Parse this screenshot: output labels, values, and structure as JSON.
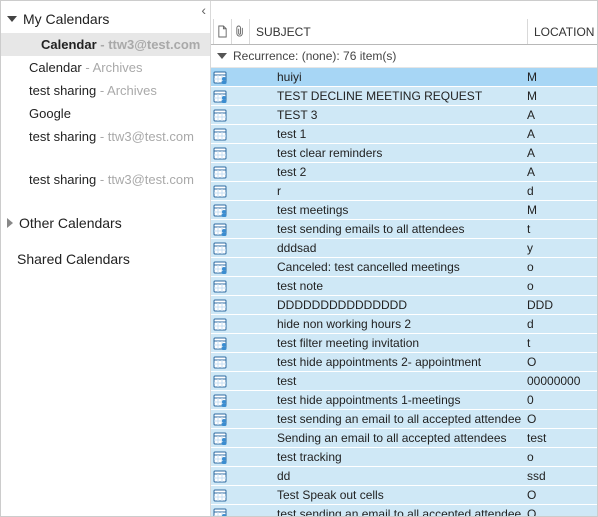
{
  "sidebar": {
    "collapse_glyph": "‹",
    "groups": [
      {
        "name": "my-calendars",
        "label": "My Calendars",
        "expanded": true,
        "items": [
          {
            "label": "Calendar",
            "suffix": " - ttw3@test.com",
            "selected": true
          },
          {
            "label": "Calendar",
            "suffix": " - Archives",
            "selected": false
          },
          {
            "label": "test sharing",
            "suffix": " - Archives",
            "selected": false
          },
          {
            "label": "Google",
            "suffix": "",
            "selected": false
          },
          {
            "label": "test sharing",
            "suffix": " - ttw3@test.com",
            "selected": false
          },
          {
            "label": "test sharing",
            "suffix": " - ttw3@test.com",
            "selected": false,
            "gapBefore": true
          }
        ]
      },
      {
        "name": "other-calendars",
        "label": "Other Calendars",
        "expanded": false,
        "items": []
      },
      {
        "name": "shared-calendars",
        "label": "Shared Calendars",
        "expanded": null,
        "items": []
      }
    ]
  },
  "columns": {
    "subject": "SUBJECT",
    "location": "LOCATION"
  },
  "grouping": {
    "label": "Recurrence: (none): 76 item(s)"
  },
  "rows": [
    {
      "icon": "meeting",
      "subject": "huiyi",
      "location": "M",
      "highlight": true
    },
    {
      "icon": "meeting",
      "subject": "TEST DECLINE MEETING REQUEST",
      "location": "M"
    },
    {
      "icon": "appt",
      "subject": "TEST 3",
      "location": "A"
    },
    {
      "icon": "appt",
      "subject": "test 1",
      "location": "A"
    },
    {
      "icon": "appt",
      "subject": "test clear reminders",
      "location": "A"
    },
    {
      "icon": "appt",
      "subject": "test 2",
      "location": "A"
    },
    {
      "icon": "appt",
      "subject": "r",
      "location": "d"
    },
    {
      "icon": "meeting",
      "subject": "test meetings",
      "location": "M"
    },
    {
      "icon": "meeting",
      "subject": "test sending emails to all attendees",
      "location": "t"
    },
    {
      "icon": "appt",
      "subject": "dddsad",
      "location": "y"
    },
    {
      "icon": "meeting",
      "subject": "Canceled: test cancelled meetings",
      "location": "o"
    },
    {
      "icon": "appt",
      "subject": "test note",
      "location": "o"
    },
    {
      "icon": "appt",
      "subject": "DDDDDDDDDDDDDDD",
      "location": "DDD"
    },
    {
      "icon": "appt",
      "subject": "hide non working hours 2",
      "location": "d"
    },
    {
      "icon": "meeting",
      "subject": "test filter meeting invitation",
      "location": "t"
    },
    {
      "icon": "appt",
      "subject": "test hide appointments 2- appointment",
      "location": "O"
    },
    {
      "icon": "appt",
      "subject": "test",
      "location": "00000000"
    },
    {
      "icon": "meeting",
      "subject": "test hide appointments 1-meetings",
      "location": "0"
    },
    {
      "icon": "meeting",
      "subject": "test sending an email to all accepted attendees",
      "location": "O"
    },
    {
      "icon": "meeting",
      "subject": "Sending an email to all accepted attendees",
      "location": "test"
    },
    {
      "icon": "meeting",
      "subject": "test tracking",
      "location": "o"
    },
    {
      "icon": "appt",
      "subject": "dd",
      "location": "ssd"
    },
    {
      "icon": "appt",
      "subject": "Test Speak out cells",
      "location": "O"
    },
    {
      "icon": "meeting",
      "subject": "test sending an email to all accepted attendees",
      "location": "O"
    }
  ],
  "iconAlt": {
    "appt": "appointment-icon",
    "meeting": "meeting-icon"
  }
}
